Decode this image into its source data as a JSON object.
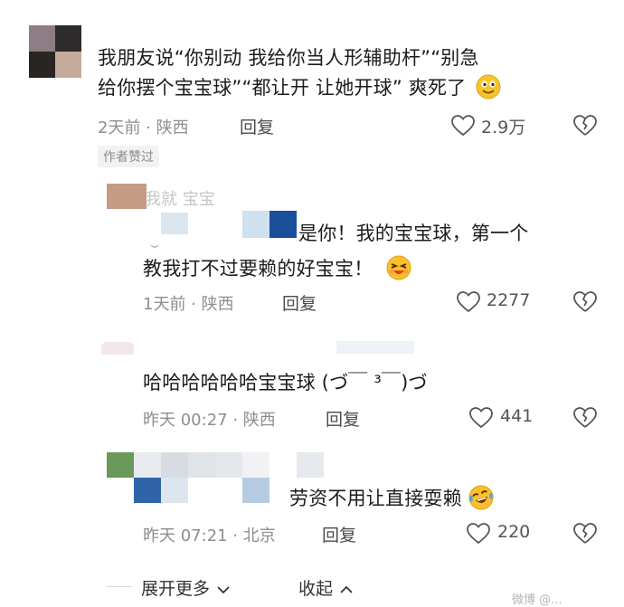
{
  "comments": [
    {
      "text_line1": "我朋友说“你别动 我给你当人形辅助杆”“别急",
      "text_line2": "给你摆个宝宝球”“都让开 让她开球” 爽死了",
      "time": "2天前 · 陕西",
      "reply_label": "回复",
      "likes": "2.9万",
      "badge": "作者赞过",
      "emoji": "smiling-face-emoji"
    },
    {
      "name_fragment": "我就  宝宝",
      "text_line1": "是你！我的宝宝球，第一个",
      "text_line2": "教我打不过要赖的好宝宝！",
      "time": "1天前 · 陕西",
      "reply_label": "回复",
      "likes": "2277",
      "emoji": "grinning-squint-emoji"
    },
    {
      "text": "哈哈哈哈哈哈宝宝球 (づ￣ ³￣)づ",
      "time": "昨天 00:27 · 陕西",
      "reply_label": "回复",
      "likes": "441"
    },
    {
      "text": "劳资不用让直接耍赖",
      "time": "昨天 07:21 · 北京",
      "reply_label": "回复",
      "likes": "220",
      "emoji": "laughing-tears-emoji"
    }
  ],
  "footer": {
    "expand_label": "展开更多",
    "collapse_label": "收起",
    "watermark": "微博 @..."
  },
  "colors": {
    "text": "#1c1c1c",
    "meta": "#8e8e8e",
    "emoji_yellow": "#f7c52b"
  }
}
